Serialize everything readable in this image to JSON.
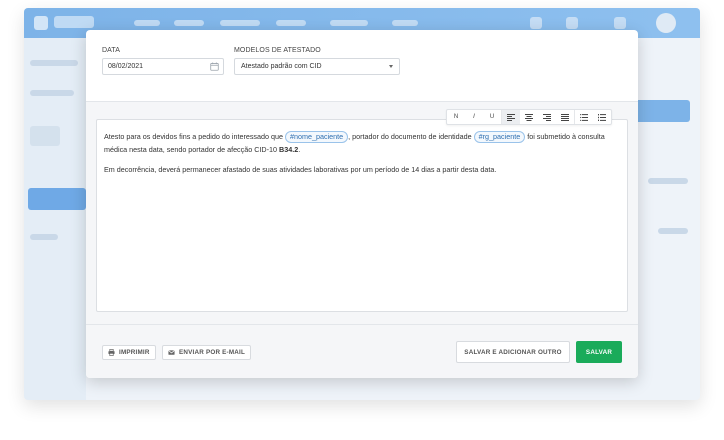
{
  "form": {
    "date_label": "DATA",
    "date_value": "08/02/2021",
    "template_label": "MODELOS DE ATESTADO",
    "template_value": "Atestado padrão com CID"
  },
  "toolbar": {
    "bold": "N",
    "italic": "I",
    "underline": "U"
  },
  "editor": {
    "p1_text1": "Atesto para os devidos fins a pedido do interessado que ",
    "tag_patient": "#nome_paciente",
    "p1_text2": ", portador do documento de identidade ",
    "tag_rg": "#rg_paciente",
    "p1_text3": " foi submetido à consulta médica nesta data, sendo portador de afecção CID-10 ",
    "cid": "B34.2",
    "p1_end": ".",
    "p2": "Em decorrência, deverá permanecer afastado de suas atividades laborativas por um período de 14 dias a partir desta data."
  },
  "footer": {
    "print_label": "IMPRIMIR",
    "email_label": "ENVIAR POR E-MAIL",
    "save_add_label": "SALVAR E ADICIONAR OUTRO",
    "save_label": "SALVAR"
  },
  "colors": {
    "save_button": "#1aab5a",
    "tag_border": "#9ac3ea",
    "tag_text": "#2f6fb0",
    "app_header": "#7db3e8"
  }
}
